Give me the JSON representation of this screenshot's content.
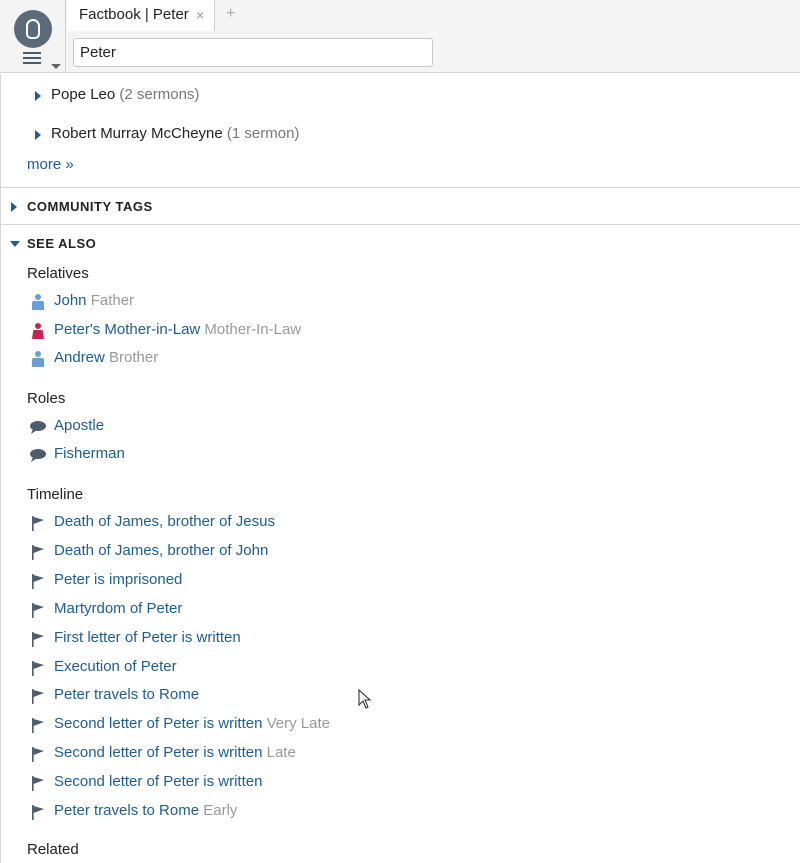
{
  "tab": {
    "title": "Factbook | Peter",
    "close_glyph": "×",
    "add_glyph": "+"
  },
  "search": {
    "value": "Peter"
  },
  "sermons": [
    {
      "name": "Pope Leo",
      "count": "(2 sermons)"
    },
    {
      "name": "Robert Murray McCheyne",
      "count": "(1 sermon)"
    }
  ],
  "more_label": "more »",
  "sections": {
    "community_tags": "COMMUNITY TAGS",
    "see_also": "SEE ALSO"
  },
  "relatives": {
    "heading": "Relatives",
    "items": [
      {
        "name": "John",
        "relation": "Father",
        "icon": "person-male-icon",
        "color": "#6a9fd6"
      },
      {
        "name": "Peter's Mother-in-Law",
        "relation": "Mother-In-Law",
        "icon": "person-female-icon",
        "color": "#c8234f"
      },
      {
        "name": "Andrew",
        "relation": "Brother",
        "icon": "person-male-icon",
        "color": "#6a9fd6"
      }
    ]
  },
  "roles": {
    "heading": "Roles",
    "items": [
      {
        "name": "Apostle",
        "icon": "speech-bubble-icon"
      },
      {
        "name": "Fisherman",
        "icon": "speech-bubble-icon"
      }
    ]
  },
  "timeline": {
    "heading": "Timeline",
    "items": [
      {
        "name": "Death of James, brother of Jesus",
        "qualifier": ""
      },
      {
        "name": "Death of James, brother of John",
        "qualifier": ""
      },
      {
        "name": "Peter is imprisoned",
        "qualifier": ""
      },
      {
        "name": "Martyrdom of Peter",
        "qualifier": ""
      },
      {
        "name": "First letter of Peter is written",
        "qualifier": ""
      },
      {
        "name": "Execution of Peter",
        "qualifier": ""
      },
      {
        "name": "Peter travels to Rome",
        "qualifier": ""
      },
      {
        "name": "Second letter of Peter is written",
        "qualifier": "Very Late"
      },
      {
        "name": "Second letter of Peter is written",
        "qualifier": "Late"
      },
      {
        "name": "Second letter of Peter is written",
        "qualifier": ""
      },
      {
        "name": "Peter travels to Rome",
        "qualifier": "Early"
      }
    ]
  },
  "related": {
    "heading": "Related"
  },
  "colors": {
    "link": "#1f5d91",
    "muted": "#999999",
    "icon": "#5b6b7a"
  }
}
